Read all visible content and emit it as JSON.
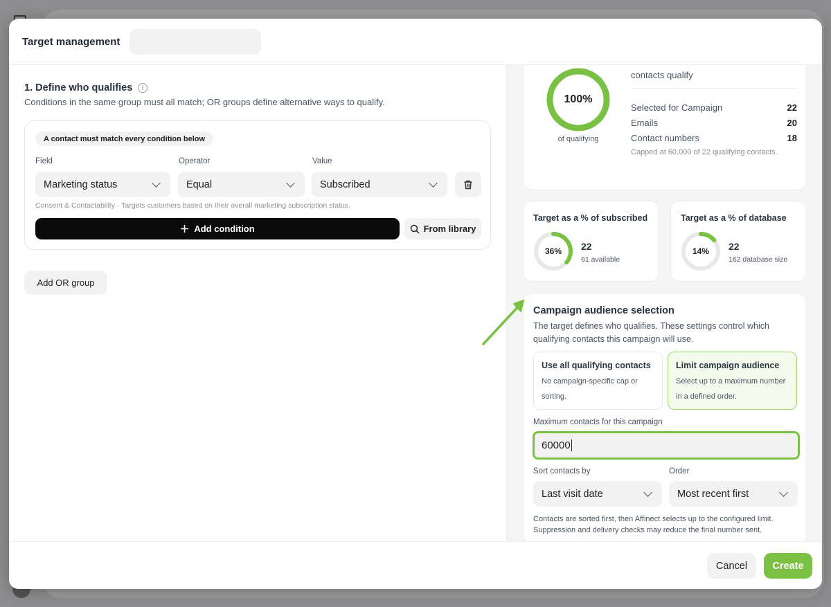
{
  "header": {
    "title": "Target management",
    "name_value": ""
  },
  "define": {
    "title": "1. Define who qualifies",
    "description": "Conditions in the same group must all match; OR groups define alternative ways to qualify.",
    "group": {
      "pill": "A contact must match every condition below",
      "field_label": "Field",
      "operator_label": "Operator",
      "value_label": "Value",
      "field_value": "Marketing status",
      "operator_value": "Equal",
      "value_value": "Subscribed",
      "hint": "Consent & Contactability · Targets customers based on their overall marketing subscription status.",
      "add_condition": "Add condition",
      "from_library": "From library"
    },
    "add_or_group": "Add OR group"
  },
  "summary": {
    "percent_value": 100,
    "percent_label": "100%",
    "caption": "of qualifying",
    "qualify_label": "contacts qualify",
    "rows": [
      {
        "label": "Selected for Campaign",
        "value": "22"
      },
      {
        "label": "Emails",
        "value": "20"
      },
      {
        "label": "Contact numbers",
        "value": "18"
      }
    ],
    "capped": "Capped at 60,000 of 22 qualifying contacts."
  },
  "subscribed_card": {
    "title": "Target as a % of subscribed",
    "percent_value": 36,
    "percent_label": "36%",
    "value": "22",
    "sub": "61 available"
  },
  "database_card": {
    "title": "Target as a % of database",
    "percent_value": 14,
    "percent_label": "14%",
    "value": "22",
    "sub": "162 database size"
  },
  "audience": {
    "title": "Campaign audience selection",
    "description": "The target defines who qualifies. These settings control which qualifying contacts this campaign will use.",
    "option_all": {
      "title": "Use all qualifying contacts",
      "desc": "No campaign-specific cap or sorting."
    },
    "option_limit": {
      "title": "Limit campaign audience",
      "desc": "Select up to a maximum number in a defined order."
    },
    "max_label": "Maximum contacts for this campaign",
    "max_value": "60000",
    "sort_label": "Sort contacts by",
    "sort_value": "Last visit date",
    "order_label": "Order",
    "order_value": "Most recent first",
    "footnote": "Contacts are sorted first, then Affinect selects up to the configured limit. Suppression and delivery checks may reduce the final number sent."
  },
  "footer": {
    "cancel": "Cancel",
    "create": "Create"
  },
  "colors": {
    "accent": "#7ac143",
    "ring_track": "#e8e8e8"
  }
}
